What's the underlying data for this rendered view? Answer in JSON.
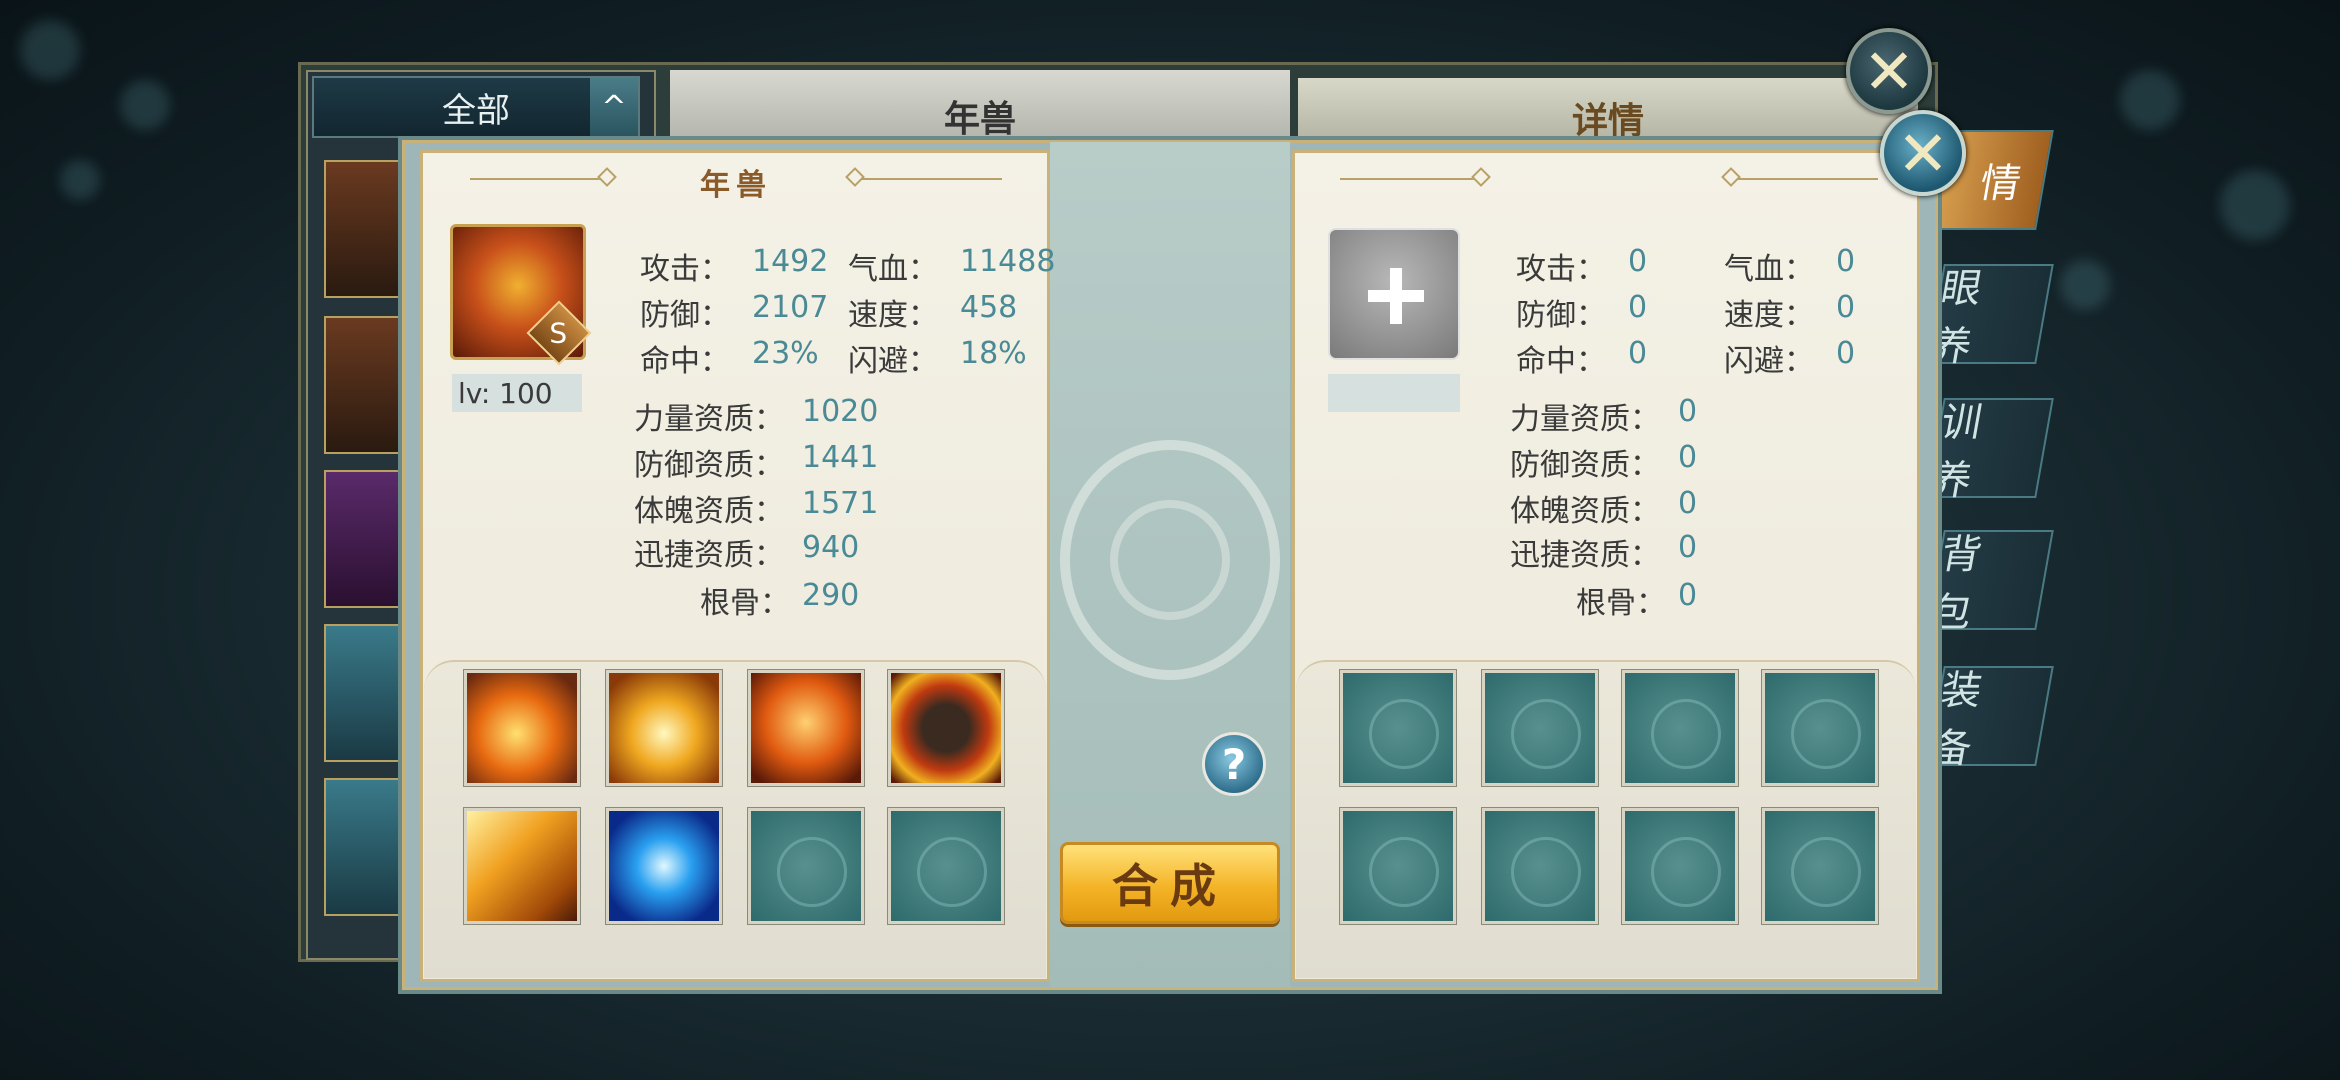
{
  "sidebar": {
    "filter_label": "全部",
    "filter_arrow": "^"
  },
  "back_panel": {
    "pet_title": "年兽",
    "detail_title": "详情",
    "tabs": [
      "情",
      "眼 养",
      "训 养",
      "背 包",
      "装 备"
    ]
  },
  "left_panel": {
    "title": "年兽",
    "grade": "S",
    "level_label": "lv: 100",
    "stats": {
      "attack_label": "攻击：",
      "attack": "1492",
      "hp_label": "气血：",
      "hp": "11488",
      "defense_label": "防御：",
      "defense": "2107",
      "speed_label": "速度：",
      "speed": "458",
      "hit_label": "命中：",
      "hit": "23%",
      "dodge_label": "闪避：",
      "dodge": "18%"
    },
    "aptitudes": {
      "strength_label": "力量资质：",
      "strength": "1020",
      "def_apt_label": "防御资质：",
      "def_apt": "1441",
      "phys_label": "体魄资质：",
      "phys": "1571",
      "agility_label": "迅捷资质：",
      "agility": "940",
      "bone_label": "根骨：",
      "bone": "290"
    },
    "skills": [
      "fire-shield-skill-icon",
      "golden-burst-skill-icon",
      "flame-shield-skill-icon",
      "beast-roar-skill-icon",
      "golden-claw-skill-icon",
      "blue-vortex-skill-icon",
      "empty",
      "empty"
    ]
  },
  "right_panel": {
    "stats": {
      "attack_label": "攻击：",
      "attack": "0",
      "hp_label": "气血：",
      "hp": "0",
      "defense_label": "防御：",
      "defense": "0",
      "speed_label": "速度：",
      "speed": "0",
      "hit_label": "命中：",
      "hit": "0",
      "dodge_label": "闪避：",
      "dodge": "0"
    },
    "aptitudes": {
      "strength_label": "力量资质：",
      "strength": "0",
      "def_apt_label": "防御资质：",
      "def_apt": "0",
      "phys_label": "体魄资质：",
      "phys": "0",
      "agility_label": "迅捷资质：",
      "agility": "0",
      "bone_label": "根骨：",
      "bone": "0"
    }
  },
  "center": {
    "help": "?",
    "compose_label": "合成"
  },
  "colors": {
    "value_teal": "#4a8a96",
    "title_brown": "#8a5a28",
    "button_gold": "#f4b428",
    "empty_slot_teal": "#2e6a6c"
  }
}
